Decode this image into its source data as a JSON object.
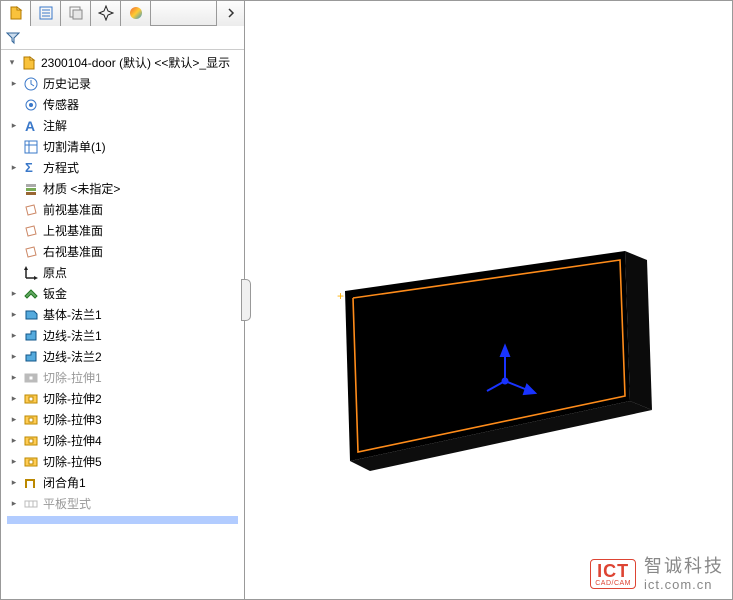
{
  "tabs": [
    "feature",
    "detail",
    "config",
    "display",
    "appearance"
  ],
  "root": {
    "label": "2300104-door (默认) <<默认>_显示"
  },
  "tree": [
    {
      "icon": "history",
      "label": "历史记录",
      "expander": true
    },
    {
      "icon": "sensor",
      "label": "传感器",
      "expander": false
    },
    {
      "icon": "annotation",
      "label": "注解",
      "expander": true
    },
    {
      "icon": "cutlist",
      "label": "切割清单(1)",
      "expander": false
    },
    {
      "icon": "equation",
      "label": "方程式",
      "expander": true
    },
    {
      "icon": "material",
      "label": "材质 <未指定>",
      "expander": false
    },
    {
      "icon": "plane",
      "label": "前视基准面",
      "expander": false
    },
    {
      "icon": "plane",
      "label": "上视基准面",
      "expander": false
    },
    {
      "icon": "plane",
      "label": "右视基准面",
      "expander": false
    },
    {
      "icon": "origin",
      "label": "原点",
      "expander": false
    },
    {
      "icon": "sheetmetal",
      "label": "钣金",
      "expander": true
    },
    {
      "icon": "baseflange",
      "label": "基体-法兰1",
      "expander": true
    },
    {
      "icon": "edgeflange",
      "label": "边线-法兰1",
      "expander": true
    },
    {
      "icon": "edgeflange",
      "label": "边线-法兰2",
      "expander": true
    },
    {
      "icon": "cutextrude",
      "label": "切除-拉伸1",
      "expander": true,
      "disabled": true
    },
    {
      "icon": "cutextrude",
      "label": "切除-拉伸2",
      "expander": true
    },
    {
      "icon": "cutextrude",
      "label": "切除-拉伸3",
      "expander": true
    },
    {
      "icon": "cutextrude",
      "label": "切除-拉伸4",
      "expander": true
    },
    {
      "icon": "cutextrude",
      "label": "切除-拉伸5",
      "expander": true
    },
    {
      "icon": "corner",
      "label": "闭合角1",
      "expander": true
    },
    {
      "icon": "flatpattern",
      "label": "平板型式",
      "expander": true,
      "disabled": true
    }
  ],
  "watermark": {
    "badge_main": "ICT",
    "badge_sub": "CAD/CAM",
    "company": "智诚科技",
    "url": "ict.com.cn"
  }
}
